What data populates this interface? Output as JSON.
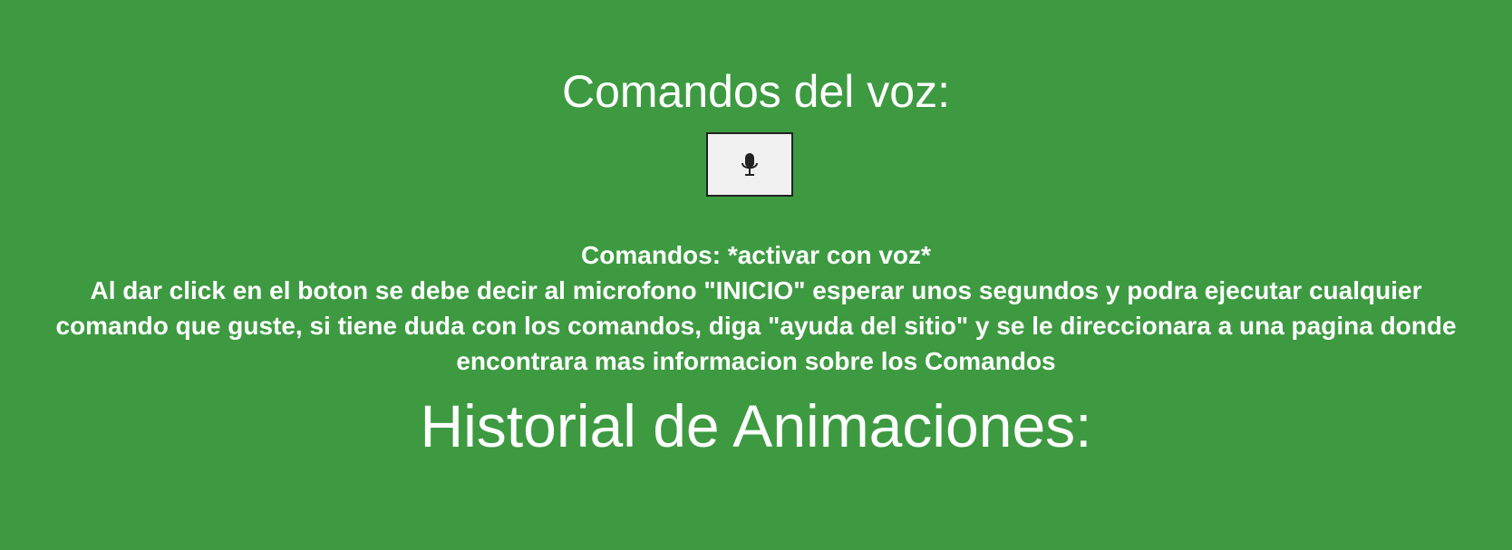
{
  "voice_section": {
    "title": "Comandos del voz:",
    "mic_button_icon": "microphone-icon"
  },
  "commands": {
    "label": "Comandos: ",
    "keyword": "*activar con voz*",
    "description": "Al dar click en el boton se debe decir al microfono \"INICIO\" esperar unos segundos y podra ejecutar cualquier comando que guste, si tiene duda con los comandos, diga \"ayuda del sitio\" y se le direccionara a una pagina donde encontrara mas informacion sobre los Comandos"
  },
  "history": {
    "title": "Historial de Animaciones:"
  },
  "colors": {
    "background": "#3d9a41",
    "text": "#ffffff",
    "button_background": "#f0f0f0",
    "button_border": "#222222"
  }
}
